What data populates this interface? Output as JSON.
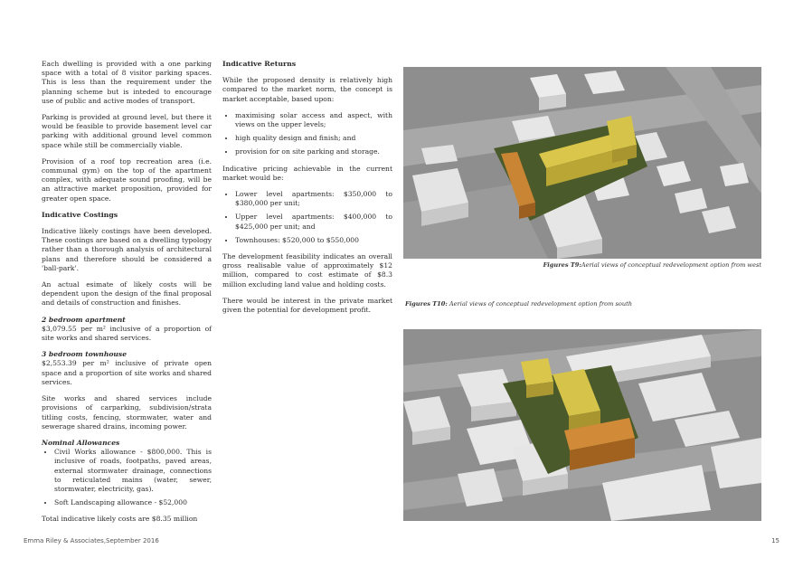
{
  "col1": {
    "p1": "Each dwelling is provided with a one parking space with a total of 8 visitor parking spaces. This is less than the requirement under the planning scheme but is inteded to encourage use of public and active modes of transport.",
    "p2": "Parking is provided at ground level, but there it would be feasible to provide basement level car parking with additional ground level common space while still be commercially viable.",
    "p3": "Provision of a roof top recreation area (i.e. communal gym) on the top of the apartment complex, with adequate sound proofing, will be an attractive market proposition, provided for greater open space.",
    "costings_heading": "Indicative Costings",
    "p4": "Indicative likely costings have been developed. These costings are based on a dwelling typology rather than a thorough analysis of architectural plans and therefore should be considered a 'ball-park'.",
    "p5": "An actual esimate of likely costs will be dependent upon the design of the final proposal and details of construction and finishes.",
    "bed2_title": "2 bedroom apartment",
    "bed2_text": "$3,079.55 per m² inclusive of a proportion of site works and shared services.",
    "bed3_title": "3 bedroom townhouse",
    "bed3_text": "$2,553.39 per m² inclusive of private open space and a proportion of site works and shared services.",
    "p6": "Site works and shared services include provisions of carparking, subdivision/strata titling costs, fencing, stormwater, water and sewerage shared drains, incoming power.",
    "nominal_title": "Nominal Allowances",
    "allowances": [
      "Civil Works allowance - $800,000. This is inclusive of roads, footpaths, paved areas, external stormwater drainage, connections to reticulated mains (water, sewer, stormwater, electricity, gas).",
      "Soft Landscaping allowance - $52,000"
    ],
    "total": "Total indicative likely costs are $8.35 million"
  },
  "col2": {
    "returns_heading": "Indicative Returns",
    "p1": "While the proposed density is relatively high compared to the market norm, the concept is market acceptable, based upon:",
    "basis": [
      "maximising solar access and aspect, with views on the upper levels;",
      "high quality design and finish; and",
      "provision for on site parking and storage."
    ],
    "p2": "Indicative pricing achievable in the current market would be:",
    "pricing": [
      "Lower level apartments: $350,000 to $380,000 per unit;",
      "Upper level apartments: $400,000 to $425,000 per unit; and",
      "Townhouses: $520,000 to $550,000"
    ],
    "p3": "The development feasibility indicates an overall gross realisable value of approximately $12 million, compared to cost estimate of $8.3 million excluding land value and holding costs.",
    "p4": "There would be interest in the private market given the potential for development profit."
  },
  "captions": {
    "fig1_label": "Figures T9:",
    "fig1_text": "Aerial views of conceptual redevelopment option from west",
    "fig2_label": "Figures T10:",
    "fig2_text": " Aerial views of conceptual redevelopment option from south"
  },
  "footer": {
    "credit": "Emma Riley & Associates,September 2016",
    "page_number": "15"
  },
  "colors": {
    "ground": "#8e8e8e",
    "road": "#a8a8a8",
    "building": "#e6e6e6",
    "site": "#4a5a2a",
    "apartments": "#c9b63a",
    "townhouses": "#c07a2a"
  }
}
